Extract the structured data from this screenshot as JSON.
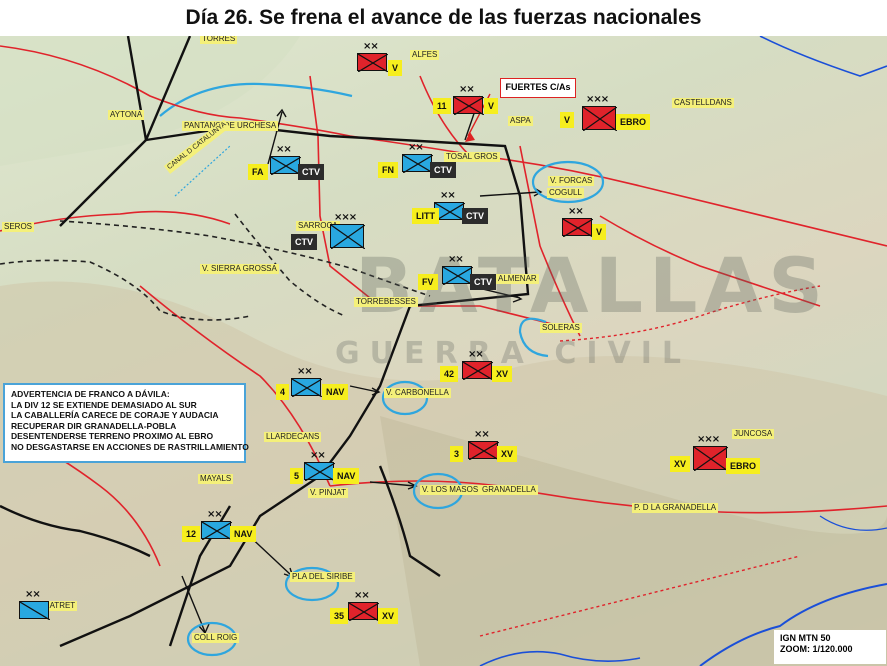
{
  "title": "Día 26. Se frena el avance de las fuerzas nacionales",
  "colors": {
    "nationalist": "#29a8e0",
    "republican": "#e0232b",
    "tag_yellow": "#f6ee1e",
    "tag_black": "#2c2c2c",
    "front_line": "#111111",
    "rivers": "#1a4fd8",
    "roads": "#e0232b",
    "objective_circles": "#29a8e0"
  },
  "callout": "FUERTES C/As",
  "note": {
    "lines": [
      "ADVERTENCIA DE FRANCO A DÁVILA:",
      "LA DIV 12 SE EXTIENDE DEMASIADO AL SUR",
      "LA CABALLERÍA CARECE DE CORAJE Y AUDACIA",
      "RECUPERAR DIR GRANADELLA-POBLA",
      "DESENTENDERSE TERRENO PROXIMO AL EBRO",
      "NO DESGASTARSE EN ACCIONES DE RASTRILLAMIENTO"
    ]
  },
  "map_info": {
    "line1": "IGN MTN 50",
    "line2": "ZOOM: 1/120.000"
  },
  "watermark": {
    "main": "BATALLAS",
    "sub": "GUERRA CIVIL"
  },
  "places": [
    "TORRES",
    "ALFES",
    "ASPA",
    "TOSAL GROS",
    "AYTONA",
    "PANTANO DE URCHESA",
    "SEROS",
    "SARROCA",
    "V. SIERRA GROSSA",
    "TORREBESSES",
    "SOLERAS",
    "LLARDECANS",
    "MAYALS",
    "V. CARBONELLA",
    "V. LOS MASOS",
    "GRANADELLA",
    "V. PINJAT",
    "JUNCOSA",
    "P. D LA GRANADELLA",
    "PLA DEL SIRIBE",
    "COLL ROIG",
    "LLMATRET",
    "V. FORCAS",
    "COGULL",
    "CASTELLDANS",
    "CANAL D CATALUNYA",
    "ALMENAR"
  ],
  "units": [
    {
      "side": "republican",
      "echelon": "××",
      "num": "",
      "type": "V"
    },
    {
      "side": "republican",
      "echelon": "××",
      "num": "11",
      "type": "V"
    },
    {
      "side": "republican",
      "echelon": "×××",
      "num": "V",
      "type": "EBRO"
    },
    {
      "side": "nationalist",
      "echelon": "××",
      "num": "FA",
      "type": "CTV"
    },
    {
      "side": "nationalist",
      "echelon": "××",
      "num": "FN",
      "type": "CTV"
    },
    {
      "side": "nationalist",
      "echelon": "××",
      "num": "LITT",
      "type": "CTV"
    },
    {
      "side": "nationalist",
      "echelon": "×××",
      "num": "",
      "type": "CTV"
    },
    {
      "side": "nationalist",
      "echelon": "××",
      "num": "FV",
      "type": "CTV"
    },
    {
      "side": "republican",
      "echelon": "××",
      "num": "",
      "type": "V"
    },
    {
      "side": "republican",
      "echelon": "××",
      "num": "42",
      "type": "XV"
    },
    {
      "side": "nationalist",
      "echelon": "××",
      "num": "4",
      "type": "NAV"
    },
    {
      "side": "republican",
      "echelon": "××",
      "num": "3",
      "type": "XV"
    },
    {
      "side": "republican",
      "echelon": "×××",
      "num": "XV",
      "type": "EBRO"
    },
    {
      "side": "nationalist",
      "echelon": "××",
      "num": "5",
      "type": "NAV"
    },
    {
      "side": "nationalist",
      "echelon": "××",
      "num": "12",
      "type": "NAV"
    },
    {
      "side": "republican",
      "echelon": "××",
      "num": "35",
      "type": "XV"
    },
    {
      "side": "nationalist",
      "echelon": "××",
      "num": "",
      "type": ""
    }
  ]
}
